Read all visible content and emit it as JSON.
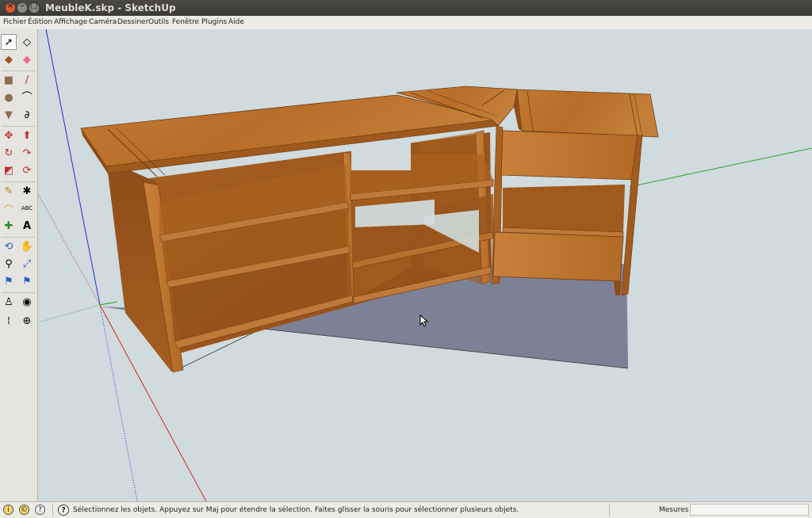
{
  "window": {
    "title": "MeubleK.skp - SketchUp"
  },
  "menu": {
    "items": [
      {
        "label": "Fichier"
      },
      {
        "label": "Édition"
      },
      {
        "label": "Affichage"
      },
      {
        "label": "Caméra"
      },
      {
        "label": "Dessiner"
      },
      {
        "label": "Outils"
      },
      {
        "label": "Fenêtre"
      },
      {
        "label": "Plugins"
      },
      {
        "label": "Aide"
      }
    ]
  },
  "tools": [
    "select-icon",
    "eraser-icon",
    "paint-bucket-icon",
    "eraser-pink-icon",
    "rectangle-icon",
    "pencil-icon",
    "circle-icon",
    "arc-icon",
    "polygon-icon",
    "freehand-icon",
    "move-icon",
    "push-pull-icon",
    "rotate-icon",
    "follow-me-icon",
    "scale-icon",
    "offset-icon",
    "tape-measure-icon",
    "dimension-icon",
    "protractor-icon",
    "text-icon",
    "axes-icon",
    "3d-text-icon",
    "orbit-icon",
    "pan-icon",
    "zoom-icon",
    "zoom-extents-icon",
    "previous-view-icon",
    "next-view-icon",
    "position-camera-icon",
    "look-around-icon",
    "walk-icon",
    "section-plane-icon"
  ],
  "status": {
    "message": "Sélectionnez les objets. Appuyez sur Maj pour étendre la sélection. Faites glisser la souris pour sélectionner plusieurs objets.",
    "measures_label": "Mesures",
    "measures_value": ""
  },
  "colors": {
    "sky": "#cfdbdd",
    "shadow": "#7d8195",
    "wood": "#b86d28",
    "red_axis": "#d02a2a",
    "green_axis": "#2fa02f",
    "blue_axis": "#2a2ad0"
  }
}
